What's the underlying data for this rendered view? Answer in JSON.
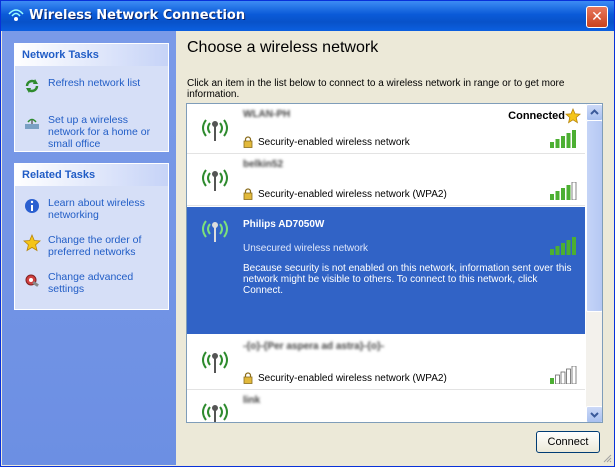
{
  "window": {
    "title": "Wireless Network Connection",
    "close_label": "✕"
  },
  "sidebar": {
    "network_tasks": {
      "header": "Network Tasks",
      "items": [
        {
          "label": "Refresh network list",
          "icon": "refresh-icon"
        },
        {
          "label": "Set up a wireless network for a home or small office",
          "icon": "setup-wireless-icon"
        }
      ]
    },
    "related_tasks": {
      "header": "Related Tasks",
      "items": [
        {
          "label": "Learn about wireless networking",
          "icon": "info-icon"
        },
        {
          "label": "Change the order of preferred networks",
          "icon": "star-icon"
        },
        {
          "label": "Change advanced settings",
          "icon": "settings-icon"
        }
      ]
    }
  },
  "main": {
    "heading": "Choose a wireless network",
    "instructions": "Click an item in the list below to connect to a wireless network in range or to get more information."
  },
  "networks": [
    {
      "ssid": "WLAN-PH",
      "security": "Security-enabled wireless network",
      "status": "Connected",
      "signal_bars": 5,
      "selected": false
    },
    {
      "ssid": "belkin52",
      "security": "Security-enabled wireless network (WPA2)",
      "status": "",
      "signal_bars": 4,
      "selected": false
    },
    {
      "ssid": "Philips AD7050W",
      "security": "Unsecured wireless network",
      "status": "",
      "signal_bars": 5,
      "selected": true,
      "description": "Because security is not enabled on this network, information sent over this network might be visible to others. To connect to this network, click Connect."
    },
    {
      "ssid": "-{o}-{Per aspera ad astra}-{o}-",
      "security": "Security-enabled wireless network (WPA2)",
      "status": "",
      "signal_bars": 1,
      "selected": false
    },
    {
      "ssid": "link",
      "security": "",
      "status": "",
      "signal_bars": 0,
      "selected": false
    }
  ],
  "buttons": {
    "connect": "Connect"
  },
  "colors": {
    "titlebar": "#0a5ad8",
    "sidebar": "#6c8fe3",
    "selected": "#3163c6",
    "link_text": "#215dc6",
    "signal_active": "#4caf32"
  }
}
